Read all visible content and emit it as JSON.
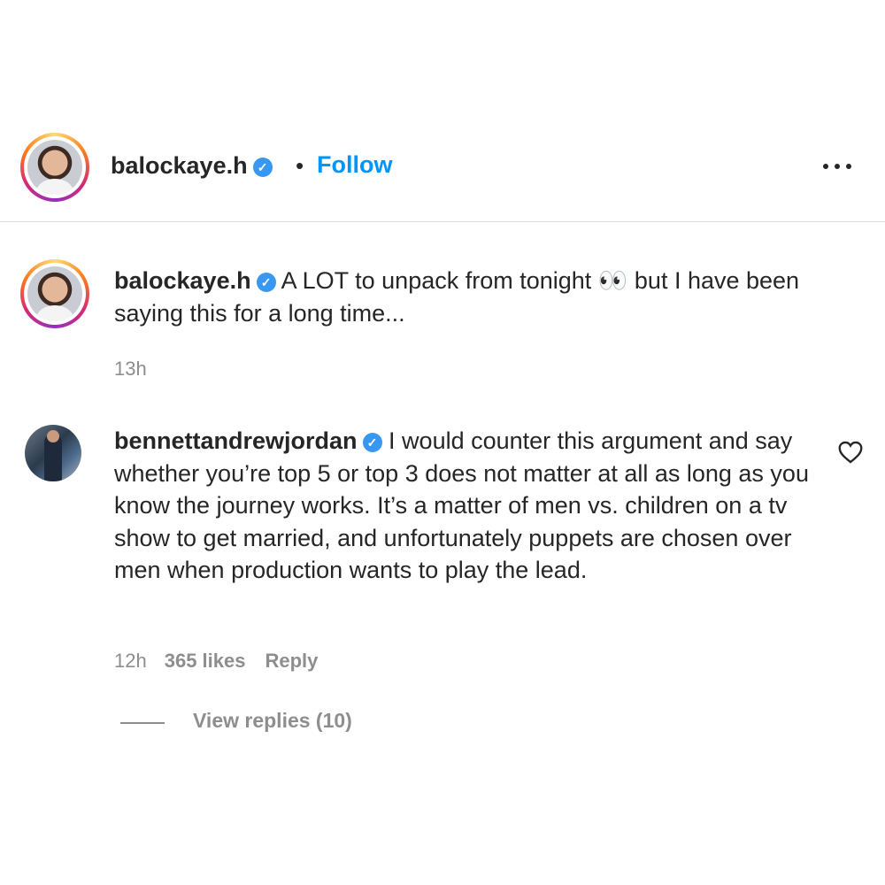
{
  "post_header": {
    "username": "balockaye.h",
    "verified_icon": "verified-badge-icon",
    "separator": "•",
    "follow_label": "Follow",
    "more_icon": "more-options-icon"
  },
  "caption": {
    "username": "balockaye.h",
    "text": "A LOT to unpack from tonight 👀 but I have been saying this for a long time...",
    "time": "13h"
  },
  "comment": {
    "username": "bennettandrewjordan",
    "text": "I would counter this argument and say whether you’re top 5 or top 3 does not matter at all as long as you know the journey works. It’s a matter of men vs. children on a tv show to get married, and unfortunately puppets are chosen over men when production wants to play the lead.",
    "time": "12h",
    "likes": "365 likes",
    "reply_label": "Reply",
    "like_icon": "heart-icon",
    "view_replies": "View replies (10)"
  },
  "colors": {
    "link_blue": "#0095f6",
    "verified_blue": "#3897f0",
    "muted_gray": "#8e8e8e",
    "text": "#262626"
  }
}
